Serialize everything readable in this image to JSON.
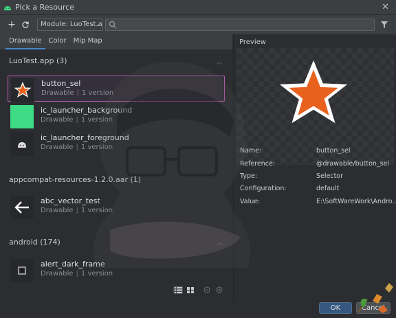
{
  "window": {
    "title": "Pick a Resource"
  },
  "toolbar": {
    "module_label": "Module: LuoTest.ap",
    "search_placeholder": ""
  },
  "tabs": [
    {
      "label": "Drawable",
      "active": true
    },
    {
      "label": "Color",
      "active": false
    },
    {
      "label": "Mip Map",
      "active": false
    }
  ],
  "sections": [
    {
      "header": "LuoTest.app (3)",
      "items": [
        {
          "name": "button_sel",
          "type": "Drawable",
          "versions": "1 version",
          "thumb": "star-icon",
          "selected": true
        },
        {
          "name": "ic_launcher_background",
          "type": "Drawable",
          "versions": "1 version",
          "thumb": "green-grid-icon",
          "selected": false
        },
        {
          "name": "ic_launcher_foreground",
          "type": "Drawable",
          "versions": "1 version",
          "thumb": "android-icon",
          "selected": false
        }
      ]
    },
    {
      "header": "appcompat-resources-1.2.0.aar (1)",
      "items": [
        {
          "name": "abc_vector_test",
          "type": "Drawable",
          "versions": "1 version",
          "thumb": "arrow-left-icon",
          "selected": false
        }
      ]
    },
    {
      "header": "android (174)",
      "items": [
        {
          "name": "alert_dark_frame",
          "type": "Drawable",
          "versions": "1 version",
          "thumb": "frame-icon",
          "selected": false
        }
      ]
    }
  ],
  "preview": {
    "label": "Preview",
    "properties": [
      {
        "key": "Name:",
        "value": "button_sel"
      },
      {
        "key": "Reference:",
        "value": "@drawable/button_sel"
      },
      {
        "key": "Type:",
        "value": "Selector"
      },
      {
        "key": "Configuration:",
        "value": "default"
      },
      {
        "key": "Value:",
        "value": "E:\\SoftWareWork\\Andro..."
      }
    ]
  },
  "footer": {
    "ok_label": "OK",
    "cancel_label": "Cancel"
  },
  "colors": {
    "accent": "#4a88c7",
    "selection": "#b35ea8",
    "star_fill": "#e8621e",
    "launcher_bg": "#3ddc84"
  }
}
